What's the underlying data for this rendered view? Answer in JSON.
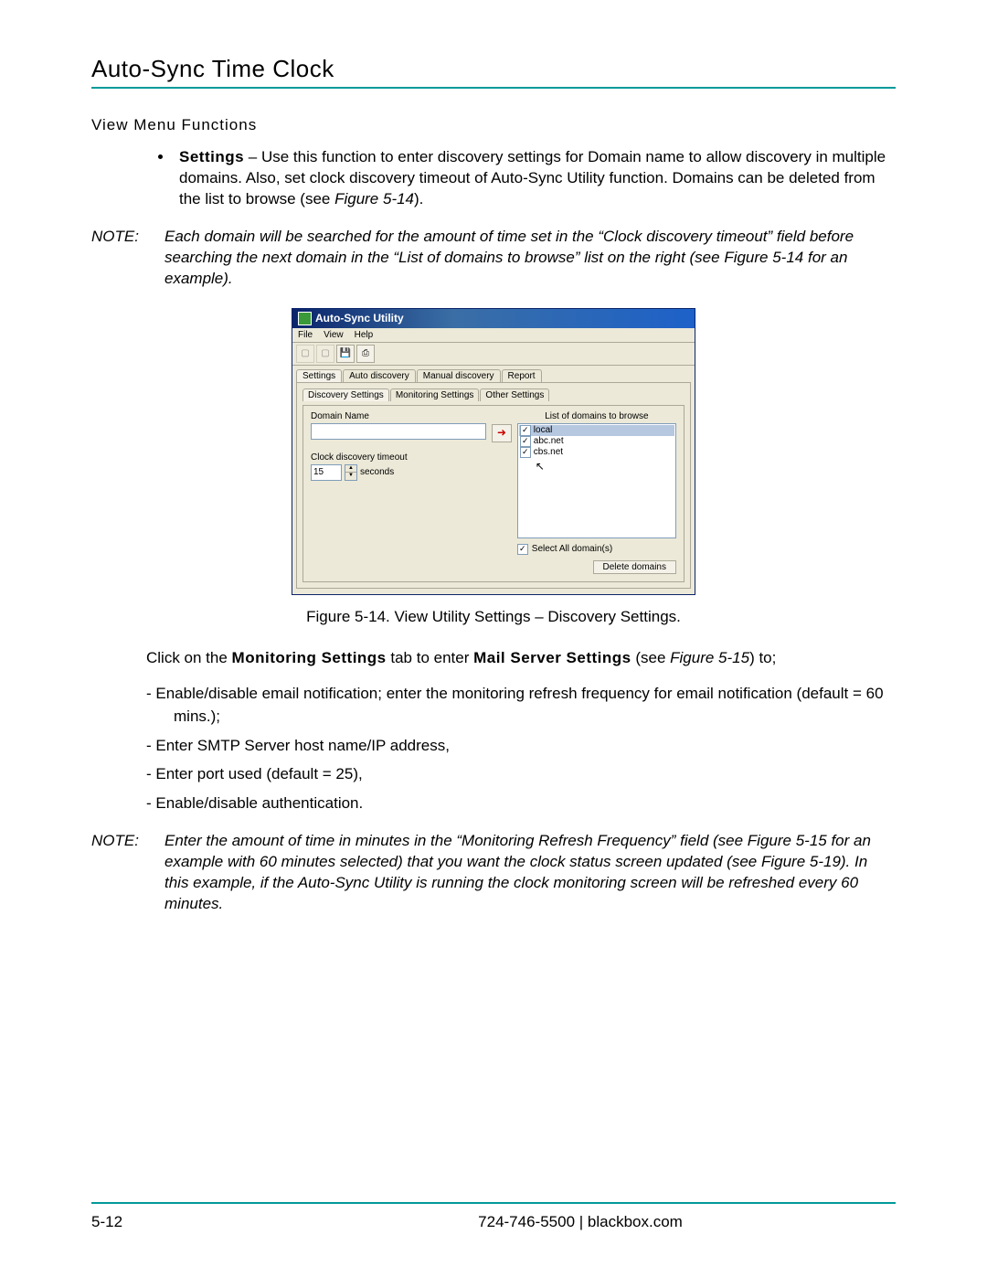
{
  "header": {
    "title": "Auto-Sync Time Clock"
  },
  "section": {
    "heading": "View Menu Functions"
  },
  "bullet": {
    "label": "Settings",
    "text": " – Use this function to enter discovery settings for Domain name to allow discovery in multiple domains. Also, set clock discovery timeout of Auto-Sync Utility function. Domains can be deleted from the list to browse (see ",
    "figref": "Figure 5-14",
    "tail": ")."
  },
  "note1": {
    "label": "NOTE:",
    "text": "Each domain will be searched for the amount of time set in the “Clock discovery timeout” field before searching the next domain in the “List of domains to browse” list on the right (see Figure 5-14 for an example)."
  },
  "screenshot": {
    "title": "Auto-Sync Utility",
    "menus": [
      "File",
      "View",
      "Help"
    ],
    "toolbar_icons": [
      "doc1",
      "doc2",
      "save",
      "print"
    ],
    "main_tabs": [
      "Settings",
      "Auto discovery",
      "Manual discovery",
      "Report"
    ],
    "main_tab_active": "Settings",
    "sub_tabs": [
      "Discovery Settings",
      "Monitoring Settings",
      "Other Settings"
    ],
    "sub_tab_active": "Discovery Settings",
    "domain_name_label": "Domain Name",
    "timeout_label": "Clock discovery timeout",
    "timeout_value": "15",
    "timeout_unit": "seconds",
    "list_label": "List of domains to browse",
    "domains": [
      {
        "name": "local",
        "checked": true,
        "selected": true
      },
      {
        "name": "abc.net",
        "checked": true,
        "selected": false
      },
      {
        "name": "cbs.net",
        "checked": true,
        "selected": false
      }
    ],
    "select_all_label": "Select All domain(s)",
    "select_all_checked": true,
    "delete_label": "Delete domains"
  },
  "figure_caption": "Figure 5-14.  View Utility Settings – Discovery Settings.",
  "para_after": {
    "pre": "Click on the ",
    "b1": "Monitoring Settings",
    "mid": " tab to enter ",
    "b2": "Mail Server Settings",
    "post": " (see ",
    "figref": "Figure 5-15",
    "tail": ") to;"
  },
  "dashes": [
    "Enable/disable email notification; enter the monitoring refresh frequency for email notification (default = 60 mins.);",
    "Enter SMTP Server host name/IP address,",
    "Enter port used (default = 25),",
    "Enable/disable authentication."
  ],
  "note2": {
    "label": "NOTE:",
    "text": "Enter the amount of time in minutes in the “Monitoring Refresh Frequency” field (see Figure 5-15 for an example with 60 minutes selected) that you want the clock status screen updated (see Figure 5-19). In this example, if the Auto-Sync Utility is running the clock monitoring screen will be refreshed every 60 minutes."
  },
  "footer": {
    "page": "5-12",
    "phone": "724-746-5500",
    "sep": "   |   ",
    "site": "blackbox.com"
  }
}
